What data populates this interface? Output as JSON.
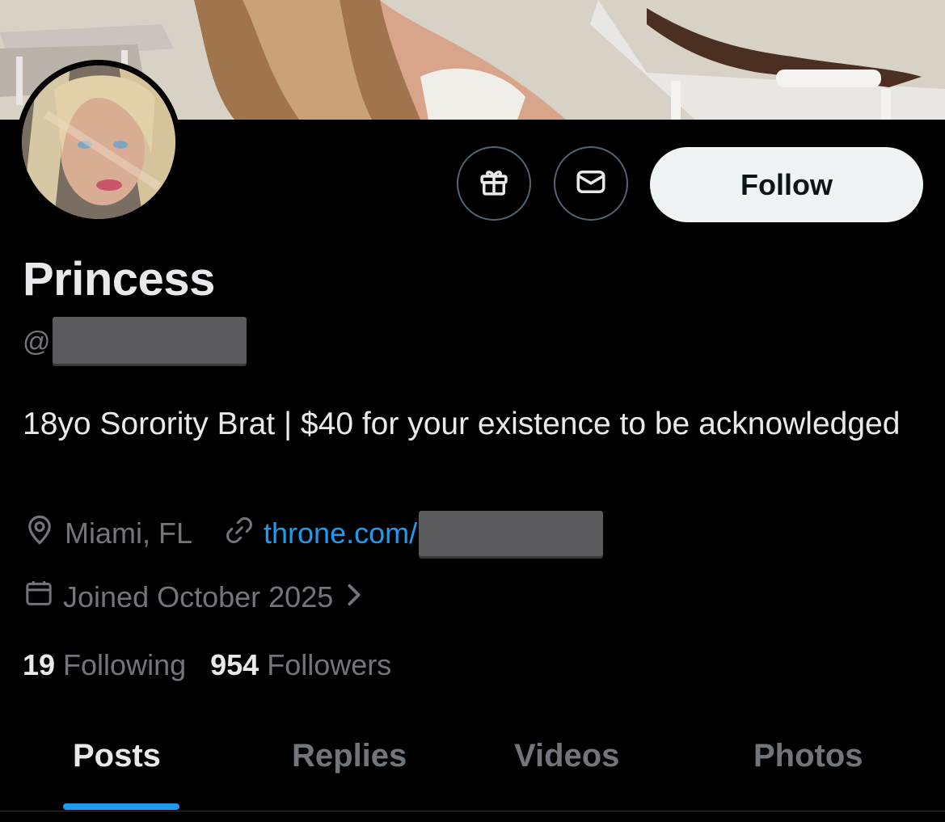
{
  "profile": {
    "name": "Princess",
    "handle_prefix": "@",
    "bio": "18yo Sorority Brat | $40 for your existence to be acknowledged",
    "location": "Miami, FL",
    "link_prefix": "throne.com/",
    "joined": "Joined October 2025",
    "following_count": "19",
    "following_label": "Following",
    "followers_count": "954",
    "followers_label": "Followers"
  },
  "actions": {
    "gift_icon": "gift-icon",
    "message_icon": "envelope-icon",
    "follow_label": "Follow"
  },
  "tabs": [
    {
      "label": "Posts",
      "active": true
    },
    {
      "label": "Replies",
      "active": false
    },
    {
      "label": "Videos",
      "active": false
    },
    {
      "label": "Photos",
      "active": false
    }
  ],
  "colors": {
    "background": "#000000",
    "text_primary": "#e7e9ea",
    "text_secondary": "#71767b",
    "accent": "#1d9bf0",
    "follow_button_bg": "#eff3f4"
  }
}
